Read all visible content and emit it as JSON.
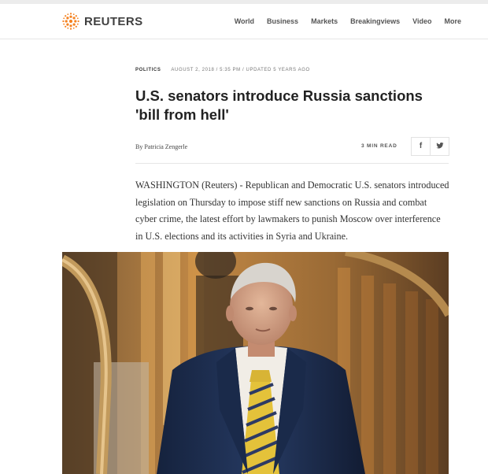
{
  "header": {
    "brand": "REUTERS",
    "nav": [
      "World",
      "Business",
      "Markets",
      "Breakingviews",
      "Video",
      "More"
    ]
  },
  "article": {
    "section": "POLITICS",
    "dateline": "AUGUST 2, 2018 / 5:35 PM / UPDATED 5 YEARS AGO",
    "headline": "U.S. senators introduce Russia sanctions 'bill from hell'",
    "byline": "By Patricia Zengerle",
    "read_time": "3 MIN READ",
    "share": {
      "facebook": "f",
      "twitter": "🐦"
    },
    "lede": "WASHINGTON (Reuters) - Republican and Democratic U.S. senators introduced legislation on Thursday to impose stiff new sanctions on Russia and combat cyber crime, the latest effort by lawmakers to punish Moscow over interference in U.S. elections and its activities in Syria and Ukraine."
  },
  "colors": {
    "brand_orange": "#f58220",
    "text": "#222222",
    "photo_background_gold": "#d59a4a",
    "suit_navy": "#1c2e4f",
    "tie_yellow": "#e4c23a"
  }
}
